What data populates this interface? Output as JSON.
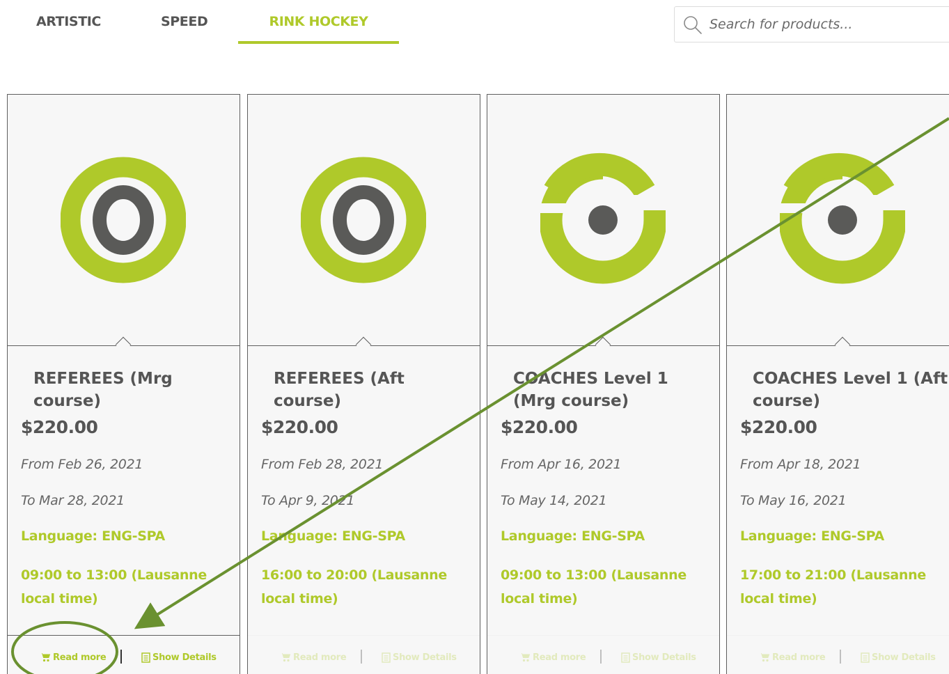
{
  "tabs": [
    {
      "label": "ARTISTIC",
      "active": false
    },
    {
      "label": "SPEED",
      "active": false
    },
    {
      "label": "RINK HOCKEY",
      "active": true
    }
  ],
  "search": {
    "placeholder": "Search for products...",
    "value": ""
  },
  "cards": [
    {
      "title": "REFEREES (Mrg course)",
      "price": "$220.00",
      "from": "From Feb 26, 2021",
      "to": "To Mar 28, 2021",
      "language": "Language: ENG-SPA",
      "time": "09:00 to 13:00 (Lausanne local time)",
      "read_more": "Read more",
      "show_details": "Show Details",
      "logo": "target-logo-icon",
      "actions_highlighted": true
    },
    {
      "title": "REFEREES (Aft course)",
      "price": "$220.00",
      "from": "From Feb 28, 2021",
      "to": "To Apr 9, 2021",
      "language": "Language: ENG-SPA",
      "time": "16:00 to 20:00 (Lausanne local time)",
      "read_more": "Read more",
      "show_details": "Show Details",
      "logo": "target-logo-icon",
      "actions_highlighted": false
    },
    {
      "title": "COACHES Level 1 (Mrg course)",
      "price": "$220.00",
      "from": "From Apr 16, 2021",
      "to": "To May 14, 2021",
      "language": "Language: ENG-SPA",
      "time": "09:00 to 13:00 (Lausanne local time)",
      "read_more": "Read more",
      "show_details": "Show Details",
      "logo": "open-ring-logo-icon",
      "actions_highlighted": false
    },
    {
      "title": "COACHES Level 1 (Aft course)",
      "price": "$220.00",
      "from": "From Apr 18, 2021",
      "to": "To May 16, 2021",
      "language": "Language: ENG-SPA",
      "time": "17:00 to 21:00 (Lausanne local time)",
      "read_more": "Read more",
      "show_details": "Show Details",
      "logo": "open-ring-logo-icon",
      "actions_highlighted": false
    }
  ],
  "colors": {
    "accent": "#afc92a",
    "text_dark": "#555555",
    "border": "#5e5e5e",
    "card_bg": "#f7f7f7",
    "annotation": "#6a9130"
  }
}
